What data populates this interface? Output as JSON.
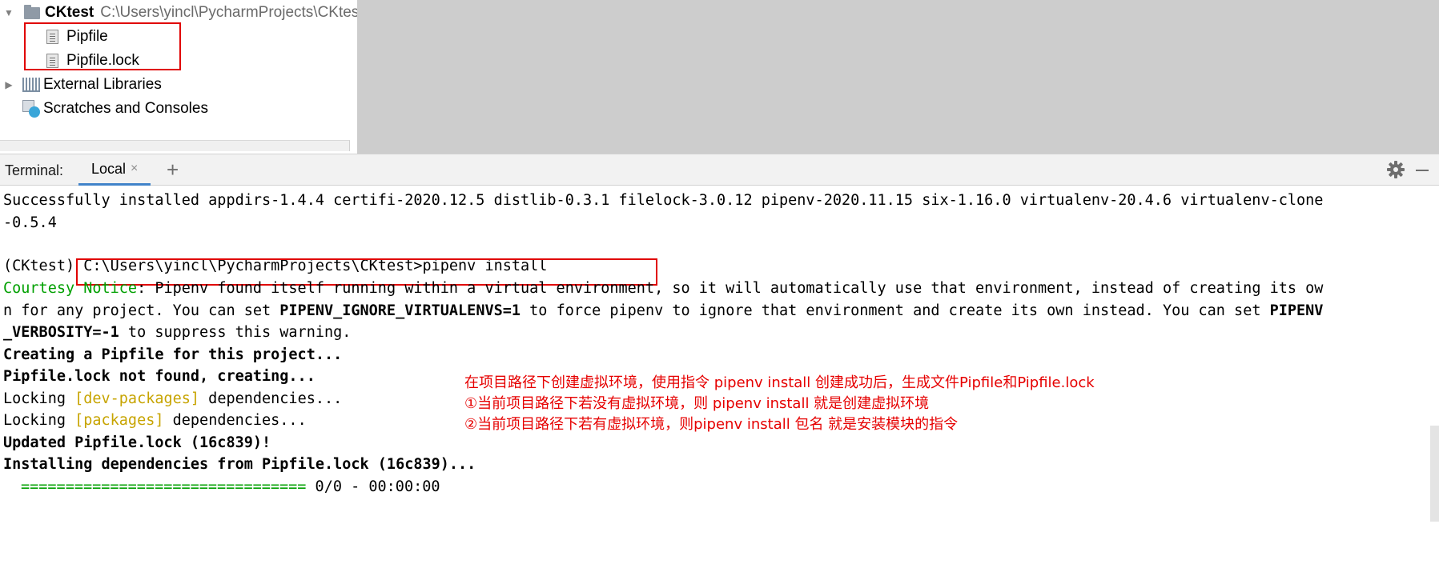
{
  "project_tree": {
    "root": {
      "name": "CKtest",
      "path": "C:\\Users\\yincl\\PycharmProjects\\CKtest"
    },
    "files": [
      "Pipfile",
      "Pipfile.lock"
    ],
    "external_libraries": "External Libraries",
    "scratches": "Scratches and Consoles"
  },
  "terminal": {
    "title": "Terminal:",
    "tab_label": "Local",
    "tab_close": "×",
    "new_tab": "+",
    "lines": {
      "l1": "Successfully installed appdirs-1.4.4 certifi-2020.12.5 distlib-0.3.1 filelock-3.0.12 pipenv-2020.11.15 six-1.16.0 virtualenv-20.4.6 virtualenv-clone",
      "l2": "-0.5.4",
      "l3_prefix": "(CKtest) ",
      "l3_cmd": "C:\\Users\\yincl\\PycharmProjects\\CKtest>pipenv install",
      "l4_notice": "Courtesy Notice",
      "l4_rest": ": Pipenv found itself running within a virtual environment, so it will automatically use that environment, instead of creating its ow",
      "l5_a": "n for any project. You can set ",
      "l5_var": "PIPENV_IGNORE_VIRTUALENVS=1",
      "l5_b": " to force pipenv to ignore that environment and create its own instead. You can set ",
      "l5_var2": "PIPENV",
      "l6_var": "_VERBOSITY=-1",
      "l6_rest": " to suppress this warning.",
      "l7": "Creating a Pipfile for this project...",
      "l8": "Pipfile.lock not found, creating...",
      "l9_a": "Locking ",
      "l9_tag": "[dev-packages]",
      "l9_b": " dependencies...",
      "l10_a": "Locking ",
      "l10_tag": "[packages]",
      "l10_b": " dependencies...",
      "l11": "Updated Pipfile.lock (16c839)!",
      "l12": "Installing dependencies from Pipfile.lock (16c839)...",
      "l13_bar": "================================",
      "l13_progress": " 0/0 - 00:00:00"
    }
  },
  "annotations": [
    "在项目路径下创建虚拟环境，使用指令  pipenv  install   创建成功后，生成文件Pipfile和Pipfile.lock",
    "①当前项目路径下若没有虚拟环境，则  pipenv  install 就是创建虚拟环境",
    "②当前项目路径下若有虚拟环境，则pipenv  install 包名 就是安装模块的指令"
  ],
  "colors": {
    "highlight_box": "#e00000",
    "annotation_text": "#e60000",
    "notice_green": "#00a000",
    "tag_yellow": "#c7a400",
    "tab_underline": "#4083c9"
  },
  "icons": [
    "folder-icon",
    "file-icon",
    "library-icon",
    "scratches-icon",
    "close-icon",
    "plus-icon",
    "gear-icon",
    "minimize-icon"
  ]
}
